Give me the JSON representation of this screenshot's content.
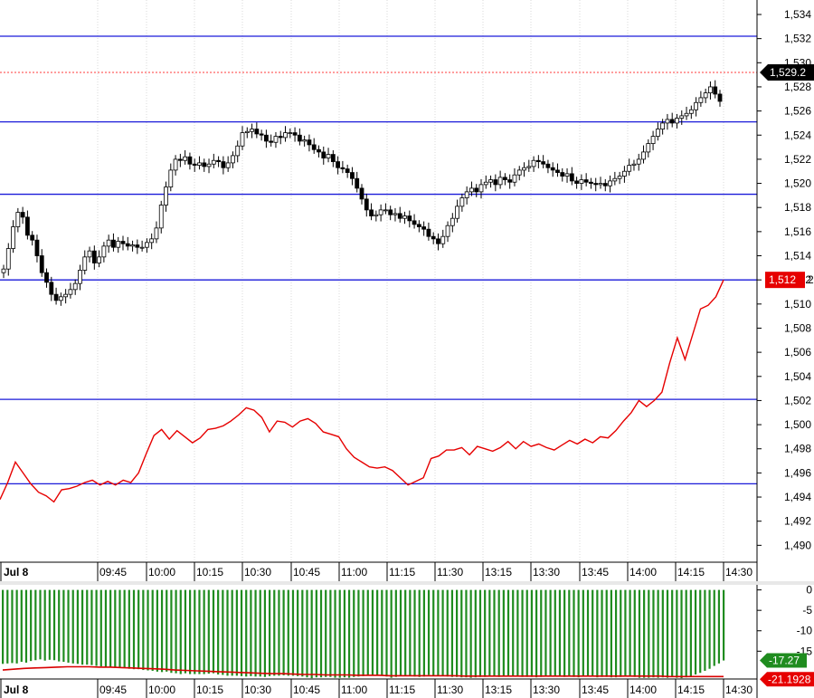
{
  "chart_data": [
    {
      "type": "candlestick",
      "price_axis": {
        "ylim": [
          1488.6,
          1535.2
        ],
        "ticks": [
          "1,534",
          "1,532",
          "1,530",
          "1,528",
          "1,526",
          "1,524",
          "1,522",
          "1,520",
          "1,518",
          "1,516",
          "1,514",
          "1,512",
          "1,510",
          "1,508",
          "1,506",
          "1,504",
          "1,502",
          "1,500",
          "1,498",
          "1,496",
          "1,494",
          "1,492",
          "1,490"
        ],
        "tick_values": [
          1534,
          1532,
          1530,
          1528,
          1526,
          1524,
          1522,
          1520,
          1518,
          1516,
          1514,
          1512,
          1510,
          1508,
          1506,
          1504,
          1502,
          1500,
          1498,
          1496,
          1494,
          1492,
          1490
        ]
      },
      "time_axis": {
        "first_label": "Jul 8",
        "labels": [
          "09:45",
          "10:00",
          "10:15",
          "10:30",
          "10:45",
          "11:00",
          "11:15",
          "11:30",
          "13:15",
          "13:30",
          "13:45",
          "14:00",
          "14:15",
          "14:30"
        ]
      },
      "horizontal_lines": [
        1532.2,
        1525.1,
        1519.1,
        1512.0,
        1502.1,
        1495.1
      ],
      "last_price_line": 1529.2,
      "last_price_label": "1,529.2",
      "red_line_tag": "1,512",
      "red_line_tag_suffix": "2",
      "candle_closes": [
        1512.9,
        1514.6,
        1516.4,
        1517.6,
        1517.2,
        1515.7,
        1515.3,
        1514.0,
        1512.6,
        1511.8,
        1510.8,
        1510.3,
        1510.6,
        1510.8,
        1511.2,
        1511.7,
        1512.8,
        1513.9,
        1514.4,
        1513.4,
        1513.9,
        1514.8,
        1515.3,
        1514.7,
        1515.2,
        1515.0,
        1514.8,
        1514.9,
        1514.7,
        1514.7,
        1515.1,
        1515.4,
        1516.3,
        1518.2,
        1519.7,
        1521.1,
        1522.0,
        1521.9,
        1522.2,
        1521.6,
        1521.5,
        1521.7,
        1521.4,
        1521.6,
        1521.9,
        1521.8,
        1521.3,
        1521.7,
        1522.3,
        1523.1,
        1524.2,
        1524.3,
        1524.5,
        1524.1,
        1524.0,
        1523.5,
        1523.4,
        1523.9,
        1523.8,
        1524.2,
        1524.2,
        1524.0,
        1523.5,
        1523.6,
        1523.2,
        1522.8,
        1522.6,
        1522.1,
        1522.4,
        1521.8,
        1521.3,
        1521.2,
        1520.9,
        1520.4,
        1519.6,
        1518.7,
        1517.8,
        1517.3,
        1517.4,
        1517.8,
        1517.8,
        1517.4,
        1517.5,
        1517.1,
        1517.3,
        1516.9,
        1516.6,
        1516.4,
        1516.2,
        1515.6,
        1515.4,
        1515.0,
        1515.6,
        1516.5,
        1517.1,
        1518.1,
        1518.8,
        1519.3,
        1519.6,
        1519.3,
        1519.9,
        1520.1,
        1520.3,
        1519.9,
        1520.5,
        1520.3,
        1520.1,
        1520.7,
        1521.1,
        1521.3,
        1521.4,
        1521.9,
        1521.8,
        1521.6,
        1521.3,
        1521.1,
        1520.9,
        1520.6,
        1520.8,
        1520.2,
        1520.0,
        1520.3,
        1520.1,
        1520.0,
        1519.9,
        1520.0,
        1519.8,
        1520.2,
        1520.4,
        1520.6,
        1521.0,
        1521.5,
        1521.6,
        1522.0,
        1522.6,
        1523.3,
        1523.9,
        1524.5,
        1525.0,
        1525.3,
        1525.0,
        1525.4,
        1525.6,
        1525.8,
        1526.1,
        1526.7,
        1527.1,
        1527.5,
        1528.0,
        1527.4,
        1526.8
      ]
    },
    {
      "type": "line",
      "series": [
        {
          "color": "#e60000",
          "values": [
            1493.8,
            1495.2,
            1496.9,
            1496.0,
            1495.1,
            1494.4,
            1494.1,
            1493.6,
            1494.6,
            1494.7,
            1494.9,
            1495.2,
            1495.4,
            1495.0,
            1495.3,
            1495.0,
            1495.4,
            1495.2,
            1496.0,
            1497.6,
            1499.1,
            1499.6,
            1498.8,
            1499.5,
            1499.0,
            1498.5,
            1498.9,
            1499.6,
            1499.7,
            1499.9,
            1500.3,
            1500.8,
            1501.4,
            1501.2,
            1500.6,
            1499.4,
            1500.3,
            1500.2,
            1499.8,
            1500.3,
            1500.5,
            1500.1,
            1499.4,
            1499.2,
            1499.0,
            1498.0,
            1497.3,
            1496.9,
            1496.5,
            1496.4,
            1496.5,
            1496.2,
            1495.6,
            1495.0,
            1495.3,
            1495.6,
            1497.2,
            1497.4,
            1497.9,
            1497.9,
            1498.1,
            1497.5,
            1498.2,
            1498.0,
            1497.8,
            1498.1,
            1498.6,
            1498.0,
            1498.6,
            1498.2,
            1498.4,
            1498.1,
            1497.9,
            1498.3,
            1498.7,
            1498.4,
            1498.8,
            1498.5,
            1499.0,
            1498.9,
            1499.5,
            1500.3,
            1501.0,
            1502.0,
            1501.5,
            1502.0,
            1502.7,
            1505.1,
            1507.2,
            1505.4,
            1507.5,
            1509.6,
            1509.9,
            1510.6,
            1512.0
          ]
        }
      ]
    },
    {
      "type": "bar",
      "ylim": [
        -21.8,
        0.8
      ],
      "ticks": [
        "0",
        "-5",
        "-10",
        "-15"
      ],
      "tick_values": [
        0,
        -5,
        -10,
        -15
      ],
      "bar_color": "#1f8c1f",
      "line_color": "#d90000",
      "last_bar_value": -17.27,
      "last_bar_label": "-17.27",
      "last_line_value": -21.1928,
      "last_line_label": "-21.1928",
      "first_label": "Jul 8",
      "labels": [
        "09:45",
        "10:00",
        "10:15",
        "10:30",
        "10:45",
        "11:00",
        "11:15",
        "11:30",
        "13:15",
        "13:30",
        "13:45",
        "14:00",
        "14:15",
        "14:30"
      ],
      "bar_values": [
        -18.1,
        -18.0,
        -17.9,
        -18.0,
        -17.6,
        -17.8,
        -17.4,
        -17.2,
        -17.0,
        -17.3,
        -17.1,
        -17.2,
        -17.5,
        -17.6,
        -17.8,
        -18.0,
        -18.1,
        -18.3,
        -18.3,
        -18.4,
        -18.6,
        -18.7,
        -18.9,
        -18.9,
        -19.0,
        -19.1,
        -19.0,
        -19.3,
        -19.4,
        -19.4,
        -19.6,
        -19.7,
        -19.8,
        -20.0,
        -20.1,
        -20.0,
        -20.3,
        -20.4,
        -20.6,
        -20.4,
        -20.6,
        -20.6,
        -20.6,
        -20.6,
        -20.5,
        -20.4,
        -20.7,
        -20.8,
        -21.0,
        -21.0,
        -21.0,
        -21.1,
        -21.2,
        -21.1,
        -21.2,
        -21.2,
        -21.3,
        -21.1,
        -21.0,
        -21.0,
        -20.9,
        -21.0,
        -21.0,
        -21.1,
        -21.2,
        -21.4,
        -21.6,
        -21.4,
        -21.4,
        -21.3,
        -21.3,
        -21.5,
        -21.5,
        -21.4,
        -21.5,
        -21.3,
        -21.2,
        -21.1,
        -20.9,
        -20.8,
        -20.8,
        -21.0,
        -21.2,
        -21.5,
        -21.3,
        -21.1,
        -20.9,
        -21.0,
        -21.2,
        -21.3,
        -21.2,
        -20.8,
        -21.0,
        -21.1,
        -21.1,
        -21.2,
        -21.3,
        -21.3,
        -21.4,
        -21.4,
        -21.5,
        -21.4,
        -21.3,
        -21.3,
        -21.2,
        -21.2,
        -21.3,
        -21.2,
        -21.1,
        -21.1,
        -21.2,
        -21.3,
        -21.3,
        -21.3,
        -21.4,
        -21.3,
        -21.2,
        -21.2,
        -21.1,
        -21.2,
        -21.3,
        -21.2,
        -21.3,
        -21.4,
        -21.2,
        -21.2,
        -21.2,
        -21.4,
        -21.3,
        -21.3,
        -21.4,
        -21.4,
        -21.3,
        -21.2,
        -21.2,
        -21.3,
        -21.5,
        -21.5,
        -21.5,
        -21.4,
        -21.5,
        -21.4,
        -21.5,
        -21.3,
        -21.5,
        -21.6,
        -21.4,
        -21.3,
        -20.7,
        -20.3,
        -19.8,
        -19.3,
        -18.6,
        -18.0,
        -17.27
      ],
      "line_values": [
        -19.6,
        -19.4,
        -19.2,
        -19.1,
        -19.0,
        -18.9,
        -18.8,
        -18.8,
        -18.8,
        -18.9,
        -18.9,
        -19.0,
        -19.1,
        -19.2,
        -19.3,
        -19.4,
        -19.6,
        -19.7,
        -19.8,
        -19.9,
        -20.0,
        -20.1,
        -20.2,
        -20.3,
        -20.4,
        -20.5,
        -20.5,
        -20.6,
        -20.7,
        -20.7,
        -20.8,
        -20.8,
        -20.8,
        -20.9,
        -20.9,
        -20.9,
        -21.0,
        -21.0,
        -21.0,
        -21.0,
        -21.0,
        -21.0,
        -21.0,
        -21.1,
        -21.1,
        -21.1,
        -21.1,
        -21.1,
        -21.1,
        -21.1,
        -21.1,
        -21.1,
        -21.1,
        -21.1,
        -21.1,
        -21.1,
        -21.1,
        -21.1,
        -21.1,
        -21.1,
        -21.1,
        -21.1,
        -21.2,
        -21.2,
        -21.2,
        -21.2,
        -21.2,
        -21.1928
      ]
    }
  ]
}
